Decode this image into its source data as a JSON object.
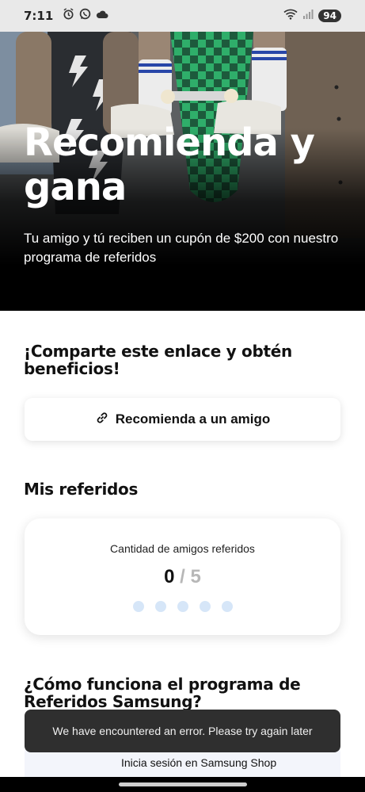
{
  "status_bar": {
    "time": "7:11",
    "battery": "94",
    "left_icons": [
      "alarm-icon",
      "whatsapp-icon",
      "cloud-icon"
    ],
    "right_icons": [
      "wifi-icon",
      "signal-icon"
    ]
  },
  "hero": {
    "title": "Recomienda y gana",
    "subtitle": "Tu amigo y tú reciben un cupón de $200 con nuestro programa de referidos"
  },
  "share": {
    "heading": "¡Comparte este enlace y obtén beneficios!",
    "button_label": "Recomienda a un amigo",
    "button_icon": "link-icon"
  },
  "referrals": {
    "heading": "Mis referidos",
    "card_label": "Cantidad de amigos referidos",
    "current": 0,
    "separator": "/",
    "max": 5
  },
  "how_it_works": {
    "heading": "¿Cómo funciona el programa de Referidos Samsung?"
  },
  "login_card": {
    "label": "Inicia sesión en Samsung Shop"
  },
  "toast": {
    "message": "We have encountered an error. Please try again later"
  },
  "colors": {
    "status_bar_bg": "#e9e9e9",
    "toast_bg": "#2f2f2f",
    "dot_inactive": "#d6e6f8",
    "count_muted": "#b7b7b7"
  }
}
